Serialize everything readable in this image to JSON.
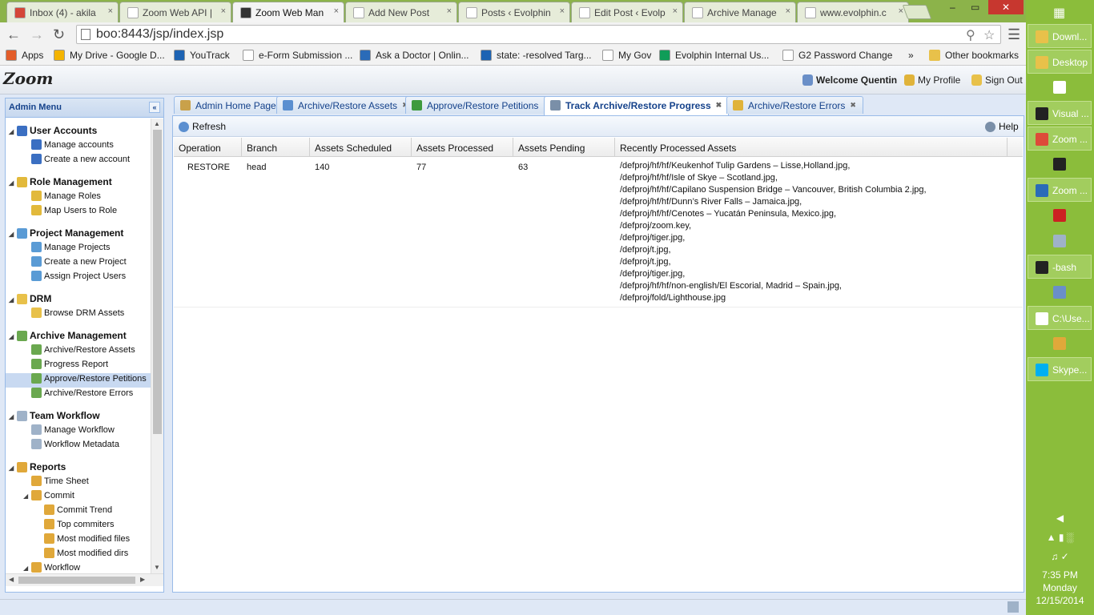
{
  "browser": {
    "tabs": [
      {
        "title": "Inbox (4) - akila",
        "icon_color": "#d44638"
      },
      {
        "title": "Zoom Web API |",
        "icon_color": "#ffffff"
      },
      {
        "title": "Zoom Web Man",
        "icon_color": "#333333"
      },
      {
        "title": "Add New Post",
        "icon_color": "#ffffff"
      },
      {
        "title": "Posts ‹ Evolphin",
        "icon_color": "#ffffff"
      },
      {
        "title": "Edit Post ‹ Evolp",
        "icon_color": "#ffffff"
      },
      {
        "title": "Archive Manage",
        "icon_color": "#ffffff"
      },
      {
        "title": "www.evolphin.c",
        "icon_color": "#ffffff"
      }
    ],
    "active_tab_index": 2,
    "url": "boo:8443/jsp/index.jsp",
    "bookmarks": [
      {
        "label": "Apps",
        "icon": "apps-grid-icon",
        "color": "#e35d2a"
      },
      {
        "label": "My Drive - Google D...",
        "icon": "drive-icon",
        "color": "#f4b400"
      },
      {
        "label": "YouTrack",
        "icon": "youtrack-icon",
        "color": "#1d63b3"
      },
      {
        "label": "e-Form Submission ...",
        "icon": "page-icon",
        "color": "#ffffff"
      },
      {
        "label": "Ask a Doctor | Onlin...",
        "icon": "rx-icon",
        "color": "#2a6bb8"
      },
      {
        "label": "state: -resolved Targ...",
        "icon": "youtrack-icon",
        "color": "#1d63b3"
      },
      {
        "label": "My Gov",
        "icon": "page-icon",
        "color": "#ffffff"
      },
      {
        "label": "Evolphin Internal Us...",
        "icon": "sheets-icon",
        "color": "#0f9d58"
      },
      {
        "label": "G2 Password Change",
        "icon": "page-icon",
        "color": "#ffffff"
      }
    ],
    "more_label": "»",
    "other_bookmarks": "Other bookmarks"
  },
  "app": {
    "logo": "Zoom",
    "welcome": "Welcome Quentin",
    "my_profile": "My Profile",
    "sign_out": "Sign Out"
  },
  "sidebar": {
    "title": "Admin Menu",
    "collapse": "«",
    "groups": [
      {
        "label": "User Accounts",
        "color": "#3b6fc2",
        "items": [
          "Manage accounts",
          "Create a new account"
        ]
      },
      {
        "label": "Role Management",
        "color": "#e2b93b",
        "items": [
          "Manage Roles",
          "Map Users to Role"
        ]
      },
      {
        "label": "Project Management",
        "color": "#5a9bd5",
        "items": [
          "Manage Projects",
          "Create a new Project",
          "Assign Project Users"
        ]
      },
      {
        "label": "DRM",
        "color": "#e8c14a",
        "items": [
          "Browse DRM Assets"
        ]
      },
      {
        "label": "Archive Management",
        "color": "#6aa84f",
        "items": [
          "Archive/Restore Assets",
          "Progress Report",
          "Approve/Restore Petitions",
          "Archive/Restore Errors"
        ]
      },
      {
        "label": "Team Workflow",
        "color": "#9fb2c8",
        "items": [
          "Manage Workflow",
          "Workflow Metadata"
        ]
      },
      {
        "label": "Reports",
        "color": "#e0a83a",
        "items": [
          "Time Sheet",
          "Commit",
          "Commit Trend",
          "Top commiters",
          "Most modified files",
          "Most modified dirs",
          "Workflow"
        ]
      }
    ],
    "selected_item": "Approve/Restore Petitions"
  },
  "content_tabs": [
    {
      "label": "Admin Home Page",
      "closable": false,
      "color": "#c9a14a"
    },
    {
      "label": "Archive/Restore Assets",
      "closable": true,
      "color": "#5b8fd0"
    },
    {
      "label": "Approve/Restore Petitions",
      "closable": true,
      "color": "#3e9a3e"
    },
    {
      "label": "Track Archive/Restore Progress",
      "closable": true,
      "color": "#7a8fa8"
    },
    {
      "label": "Archive/Restore Errors",
      "closable": true,
      "color": "#e0b33a"
    }
  ],
  "active_content_tab": 3,
  "panel_toolbar": {
    "refresh": "Refresh",
    "help": "Help"
  },
  "grid": {
    "columns": [
      "Operation",
      "Branch",
      "Assets Scheduled",
      "Assets Processed",
      "Assets Pending",
      "Recently Processed Assets"
    ],
    "rows": [
      {
        "operation": "RESTORE",
        "branch": "head",
        "scheduled": "140",
        "processed": "77",
        "pending": "63",
        "assets": [
          "/defproj/hf/hf/Keukenhof Tulip Gardens – Lisse,Holland.jpg,",
          "/defproj/hf/hf/Isle of Skye – Scotland.jpg,",
          "/defproj/hf/hf/Capilano Suspension Bridge – Vancouver, British Columbia 2.jpg,",
          "/defproj/hf/hf/Dunn’s River Falls – Jamaica.jpg,",
          "/defproj/hf/hf/Cenotes – Yucatán Peninsula, Mexico.jpg,",
          "/defproj/zoom.key,",
          "/defproj/tiger.jpg,",
          "/defproj/t.jpg,",
          "/defproj/t.jpg,",
          "/defproj/tiger.jpg,",
          "/defproj/hf/hf/non-english/El Escorial, Madrid – Spain.jpg,",
          "/defproj/fold/Lighthouse.jpg"
        ]
      }
    ]
  },
  "taskbar": {
    "items": [
      {
        "label": "Downl...",
        "boxed": true,
        "color": "#e8c14a"
      },
      {
        "label": "Desktop",
        "boxed": true,
        "color": "#e8c14a"
      },
      {
        "label": "",
        "boxed": false,
        "color": "#ffffff"
      },
      {
        "label": "Visual ...",
        "boxed": true,
        "color": "#222222"
      },
      {
        "label": "Zoom ...",
        "boxed": true,
        "color": "#dd4b39"
      },
      {
        "label": "",
        "boxed": false,
        "color": "#222222"
      },
      {
        "label": "Zoom ...",
        "boxed": true,
        "color": "#2a6bb8"
      },
      {
        "label": "",
        "boxed": false,
        "color": "#cc2222"
      },
      {
        "label": "",
        "boxed": false,
        "color": "#9fb2c8"
      },
      {
        "label": "-bash",
        "boxed": true,
        "color": "#222222"
      },
      {
        "label": "",
        "boxed": false,
        "color": "#6a8fc8"
      },
      {
        "label": "C:\\Use...",
        "boxed": true,
        "color": "#ffffff"
      },
      {
        "label": "",
        "boxed": false,
        "color": "#e0a83a"
      },
      {
        "label": "Skype...",
        "boxed": true,
        "color": "#00aff0"
      }
    ],
    "time": "7:35 PM",
    "day": "Monday",
    "date": "12/15/2014"
  }
}
